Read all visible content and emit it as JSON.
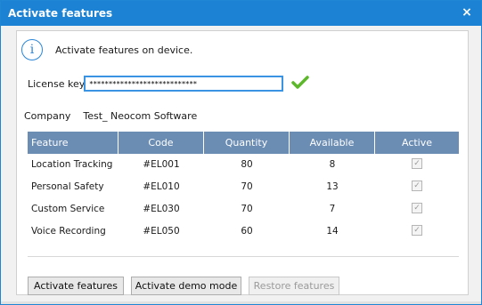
{
  "window": {
    "title": "Activate  features",
    "close_glyph": "×"
  },
  "info": {
    "icon": "info-icon",
    "glyph": "i",
    "message": "Activate features on device."
  },
  "license": {
    "label": "License key",
    "value": "****************************",
    "status_icon": "checkmark-icon",
    "status_color": "#5cb82a"
  },
  "company": {
    "label": "Company",
    "value": "Test_ Neocom Software"
  },
  "table": {
    "header_color": "#6b8cb3",
    "columns": [
      "Feature",
      "Code",
      "Quantity",
      "Available",
      "Active"
    ],
    "rows": [
      {
        "feature": "Location Tracking",
        "code": "#EL001",
        "quantity": "80",
        "available": "8",
        "active": true
      },
      {
        "feature": "Personal Safety",
        "code": "#EL010",
        "quantity": "70",
        "available": "13",
        "active": true
      },
      {
        "feature": "Custom Service",
        "code": "#EL030",
        "quantity": "70",
        "available": "7",
        "active": true
      },
      {
        "feature": "Voice Recording",
        "code": "#EL050",
        "quantity": "60",
        "available": "14",
        "active": true
      }
    ]
  },
  "buttons": {
    "activate": "Activate  features",
    "demo": "Activate demo mode",
    "restore": "Restore features"
  }
}
